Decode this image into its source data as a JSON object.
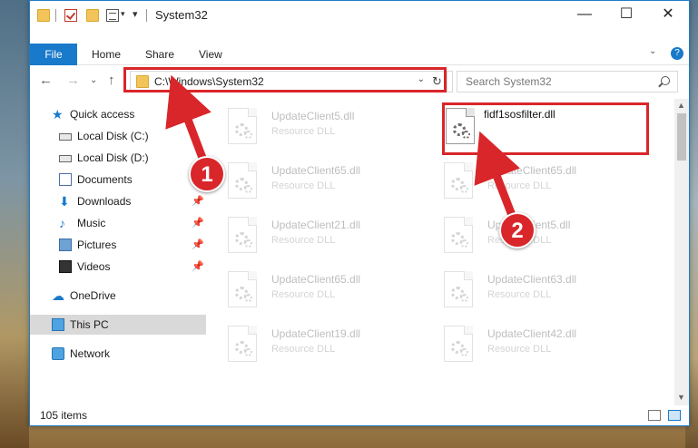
{
  "window": {
    "title": "System32",
    "controls": {
      "minimize": "—",
      "maximize": "☐",
      "close": "✕"
    }
  },
  "ribbon": {
    "tabs": [
      "File",
      "Home",
      "Share",
      "View"
    ]
  },
  "navigation": {
    "address_path": "C:\\Windows\\System32",
    "search_placeholder": "Search System32"
  },
  "sidebar": {
    "items": [
      {
        "label": "Quick access",
        "icon": "star-icon",
        "pinned": false
      },
      {
        "label": "Local Disk (C:)",
        "icon": "drive-icon",
        "pinned": false
      },
      {
        "label": "Local Disk (D:)",
        "icon": "drive-icon",
        "pinned": false
      },
      {
        "label": "Documents",
        "icon": "documents-icon",
        "pinned": false
      },
      {
        "label": "Downloads",
        "icon": "download-icon",
        "pinned": true
      },
      {
        "label": "Music",
        "icon": "music-icon",
        "pinned": true
      },
      {
        "label": "Pictures",
        "icon": "pictures-icon",
        "pinned": true
      },
      {
        "label": "Videos",
        "icon": "videos-icon",
        "pinned": true
      },
      {
        "label": "OneDrive",
        "icon": "onedrive-icon",
        "pinned": false
      },
      {
        "label": "This PC",
        "icon": "computer-icon",
        "pinned": false,
        "selected": true
      },
      {
        "label": "Network",
        "icon": "network-icon",
        "pinned": false
      }
    ]
  },
  "files": {
    "left_column": [
      {
        "name": "UpdateClient5.dll",
        "type": "Resource DLL"
      },
      {
        "name": "UpdateClient65.dll",
        "type": "Resource DLL"
      },
      {
        "name": "UpdateClient21.dll",
        "type": "Resource DLL"
      },
      {
        "name": "UpdateClient65.dll",
        "type": "Resource DLL"
      },
      {
        "name": "UpdateClient19.dll",
        "type": "Resource DLL"
      }
    ],
    "right_column": [
      {
        "name": "fidf1sosfilter.dll",
        "type": "",
        "highlighted": true
      },
      {
        "name": "UpdateClient65.dll",
        "type": "Resource DLL"
      },
      {
        "name": "UpdateClient5.dll",
        "type": "Resource DLL"
      },
      {
        "name": "UpdateClient63.dll",
        "type": "Resource DLL"
      },
      {
        "name": "UpdateClient42.dll",
        "type": "Resource DLL"
      }
    ]
  },
  "status": {
    "item_count": "105 items"
  },
  "annotations": {
    "callout_1": "1",
    "callout_2": "2",
    "highlight_color": "#d9262a"
  },
  "colors": {
    "accent": "#1979ca"
  }
}
